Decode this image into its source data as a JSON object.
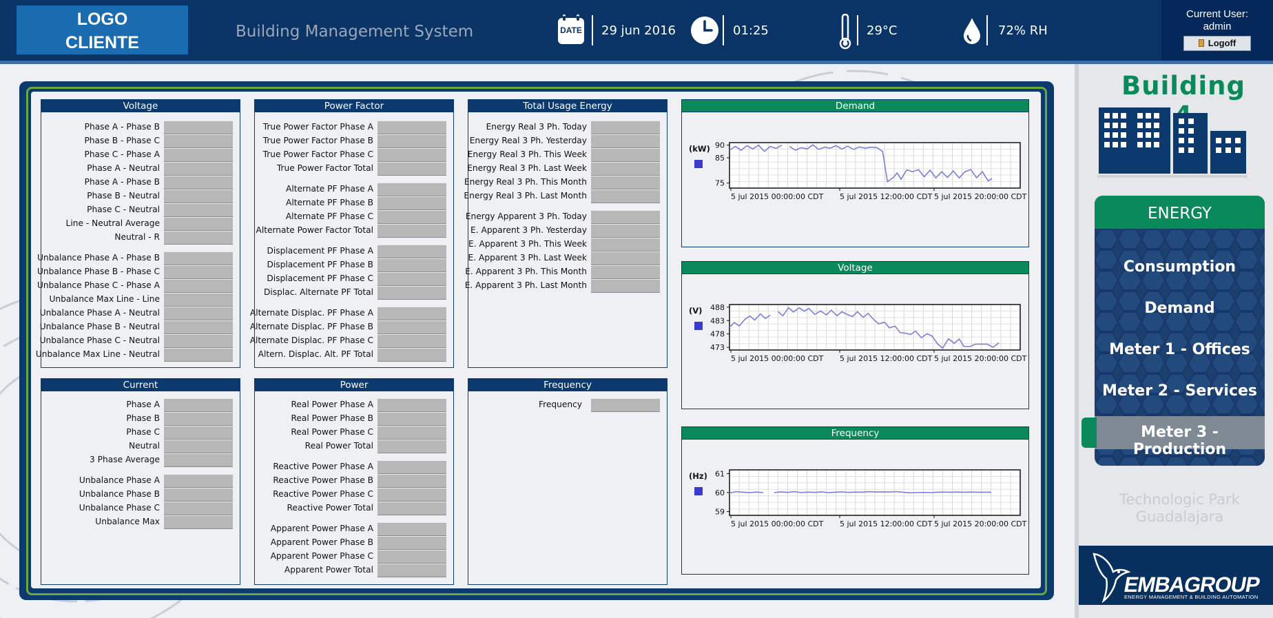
{
  "header": {
    "logo_line1": "LOGO",
    "logo_line2": "CLIENTE",
    "app_title": "Building Management System",
    "date_icon_label": "DATE",
    "date": "29 jun 2016",
    "time": "01:25",
    "temperature": "29°C",
    "humidity": "72% RH",
    "user_label": "Current User:",
    "user_name": "admin",
    "logoff_label": "Logoff"
  },
  "panels": {
    "voltage": {
      "title": "Voltage",
      "group1": [
        "Phase A - Phase B",
        "Phase B - Phase C",
        "Phase C - Phase A",
        "Phase A - Neutral",
        "Phase A - Phase B",
        "Phase B - Neutral",
        "Phase C - Neutral",
        "Line - Neutral Average",
        "Neutral - R"
      ],
      "group2": [
        "Unbalance Phase A - Phase B",
        "Unbalance Phase B - Phase C",
        "Unbalance Phase C - Phase A",
        "Unbalance Max Line - Line",
        "Unbalance Phase A - Neutral",
        "Unbalance Phase B - Neutral",
        "Unbalance Phase C - Neutral",
        "Unbalance Max Line - Neutral"
      ]
    },
    "power_factor": {
      "title": "Power Factor",
      "group1": [
        "True Power Factor Phase A",
        "True Power Factor Phase B",
        "True Power Factor Phase C",
        "True Power Factor Total"
      ],
      "group2": [
        "Alternate PF Phase A",
        "Alternate PF Phase B",
        "Alternate PF Phase C",
        "Alternate Power Factor Total"
      ],
      "group3": [
        "Displacement PF Phase A",
        "Displacement PF Phase B",
        "Displacement PF Phase C",
        "Displac. Alternate PF Total"
      ],
      "group4": [
        "Alternate Displac. PF Phase A",
        "Alternate Displac. PF Phase B",
        "Alternate Displac. PF Phase C",
        "Altern. Displac. Alt. PF Total"
      ]
    },
    "total_usage_energy": {
      "title": "Total Usage Energy",
      "group1": [
        "Energy Real 3 Ph. Today",
        "Energy Real 3 Ph. Yesterday",
        "Energy Real 3 Ph. This Week",
        "Energy Real 3 Ph. Last Week",
        "Energy Real 3 Ph. This Month",
        "Energy Real 3 Ph. Last Month"
      ],
      "group2": [
        "Energy Apparent 3 Ph. Today",
        "E. Apparent 3 Ph. Yesterday",
        "E. Apparent 3 Ph. This Week",
        "E. Apparent 3 Ph. Last Week",
        "E. Apparent 3 Ph. This Month",
        "E. Apparent 3 Ph. Last Month"
      ]
    },
    "current": {
      "title": "Current",
      "group1": [
        "Phase A",
        "Phase B",
        "Phase C",
        "Neutral",
        "3 Phase Average"
      ],
      "group2": [
        "Unbalance Phase A",
        "Unbalance Phase B",
        "Unbalance Phase C",
        "Unbalance Max"
      ]
    },
    "power": {
      "title": "Power",
      "group1": [
        "Real Power Phase A",
        "Real Power Phase B",
        "Real Power Phase C",
        "Real Power Total"
      ],
      "group2": [
        "Reactive Power Phase A",
        "Reactive Power Phase B",
        "Reactive Power Phase C",
        "Reactive Power Total"
      ],
      "group3": [
        "Apparent Power Phase A",
        "Apparent Power Phase B",
        "Apparent Power Phase C",
        "Apparent Power Total"
      ]
    },
    "frequency": {
      "title": "Frequency",
      "group1": [
        "Frequency"
      ]
    }
  },
  "chart_data": [
    {
      "type": "line",
      "title": "Demand",
      "ylabel": "(kW)",
      "ylim": [
        73,
        91
      ],
      "yticks": [
        75,
        85,
        90
      ],
      "xticks": [
        "5 jul 2015 00:00:00 CDT",
        "5 jul 2015 12:00:00 CDT",
        "5 jul 2015 20:00:00 CDT"
      ],
      "xlim": [
        0,
        30
      ],
      "grid": true,
      "series": [
        {
          "segments": [
            [
              [
                0,
                88
              ],
              [
                0.6,
                89.5
              ],
              [
                1.2,
                88
              ],
              [
                1.8,
                89.8
              ],
              [
                2.4,
                88.5
              ],
              [
                3,
                90
              ],
              [
                3.6,
                87.5
              ],
              [
                4.2,
                89.5
              ],
              [
                4.8,
                88.7
              ],
              [
                5.4,
                90
              ]
            ],
            [
              [
                6.2,
                89.5
              ],
              [
                6.8,
                88
              ],
              [
                7.4,
                89
              ],
              [
                8,
                88.5
              ],
              [
                8.6,
                90.1
              ],
              [
                9.2,
                88.3
              ],
              [
                9.8,
                89.2
              ],
              [
                10.4,
                88.8
              ],
              [
                11,
                89.8
              ],
              [
                11.6,
                88.4
              ],
              [
                12.2,
                89.6
              ],
              [
                12.8,
                88.3
              ],
              [
                13.4,
                89.3
              ],
              [
                14,
                88.8
              ],
              [
                14.6,
                89.2
              ],
              [
                15.2,
                89
              ],
              [
                15.8,
                87.5
              ],
              [
                16.3,
                75.5
              ],
              [
                16.9,
                77.2
              ],
              [
                17.3,
                79
              ],
              [
                17.7,
                76.5
              ],
              [
                18.3,
                80.2
              ],
              [
                18.9,
                79.5
              ],
              [
                19.5,
                80.3
              ],
              [
                20.1,
                77.5
              ],
              [
                20.7,
                80.1
              ],
              [
                21.3,
                77
              ],
              [
                21.9,
                79.5
              ],
              [
                22.5,
                77.2
              ],
              [
                23.1,
                79.8
              ],
              [
                23.7,
                77
              ],
              [
                24.3,
                79.5
              ],
              [
                24.9,
                80.3
              ],
              [
                25.5,
                77.1
              ],
              [
                26.1,
                79.5
              ],
              [
                26.7,
                75.8
              ],
              [
                27.1,
                76.8
              ]
            ]
          ]
        }
      ]
    },
    {
      "type": "line",
      "title": "Voltage",
      "ylabel": "(V)",
      "ylim": [
        472,
        489
      ],
      "yticks": [
        473,
        478,
        483,
        488
      ],
      "xticks": [
        "5 jul 2015 00:00:00 CDT",
        "5 jul 2015 12:00:00 CDT",
        "5 jul 2015 20:00:00 CDT"
      ],
      "xlim": [
        0,
        30
      ],
      "grid": true,
      "series": [
        {
          "segments": [
            [
              [
                0,
                480.5
              ],
              [
                0.5,
                482.3
              ],
              [
                1,
                481
              ],
              [
                1.6,
                483.5
              ],
              [
                2.1,
                484.7
              ],
              [
                2.6,
                483.2
              ],
              [
                3.2,
                485.5
              ],
              [
                3.7,
                483.8
              ],
              [
                4.2,
                485
              ]
            ],
            [
              [
                5,
                486.4
              ],
              [
                5.5,
                484.8
              ],
              [
                6.1,
                487.8
              ],
              [
                6.6,
                486.2
              ],
              [
                7.2,
                487.8
              ],
              [
                7.7,
                486.5
              ],
              [
                8.2,
                487.5
              ],
              [
                8.8,
                485.3
              ],
              [
                9.4,
                486.6
              ],
              [
                10,
                485.1
              ],
              [
                10.5,
                486.9
              ],
              [
                11.1,
                484.8
              ],
              [
                11.6,
                486.3
              ],
              [
                12.2,
                485.2
              ],
              [
                12.7,
                484.5
              ],
              [
                13.2,
                486.3
              ],
              [
                13.8,
                484.2
              ],
              [
                14.3,
                485.7
              ],
              [
                14.9,
                483.3
              ],
              [
                15.4,
                481.8
              ],
              [
                16,
                482.4
              ],
              [
                16.5,
                480.3
              ],
              [
                17.1,
                480.9
              ],
              [
                17.6,
                478.5
              ],
              [
                18.1,
                478.3
              ],
              [
                18.7,
                477.8
              ],
              [
                19.2,
                479.1
              ],
              [
                19.8,
                476.6
              ],
              [
                20.4,
                478.1
              ],
              [
                20.9,
                477.2
              ],
              [
                21.5,
                474.2
              ],
              [
                22,
                472.7
              ],
              [
                22.6,
                476.2
              ],
              [
                23.2,
                474.5
              ],
              [
                23.7,
                476.1
              ],
              [
                24.2,
                473.3
              ],
              [
                24.8,
                473.3
              ],
              [
                25.4,
                474.2
              ],
              [
                26,
                474.2
              ],
              [
                26.6,
                474.2
              ],
              [
                27.2,
                473
              ],
              [
                27.8,
                474.7
              ]
            ]
          ]
        }
      ]
    },
    {
      "type": "line",
      "title": "Frequency",
      "ylabel": "(Hz)",
      "ylim": [
        58.8,
        61.2
      ],
      "yticks": [
        59,
        60,
        61
      ],
      "xticks": [
        "5 jul 2015 00:00:00 CDT",
        "5 jul 2015 12:00:00 CDT",
        "5 jul 2015 20:00:00 CDT"
      ],
      "xlim": [
        0,
        30
      ],
      "grid": true,
      "series": [
        {
          "segments": [
            [
              [
                0,
                59.98
              ],
              [
                0.7,
                60.05
              ],
              [
                1.4,
                60.02
              ],
              [
                2.1,
                60
              ],
              [
                2.8,
                60.03
              ],
              [
                3.5,
                60
              ]
            ],
            [
              [
                4.6,
                60
              ],
              [
                5.3,
                60.04
              ],
              [
                6,
                60.01
              ],
              [
                6.7,
                60.05
              ],
              [
                7.4,
                60
              ],
              [
                8.1,
                60.03
              ],
              [
                8.8,
                60.01
              ],
              [
                9.5,
                60.04
              ],
              [
                10.2,
                60
              ],
              [
                10.9,
                60.02
              ],
              [
                11.6,
                60.04
              ],
              [
                12.3,
                60.01
              ],
              [
                13,
                60.03
              ],
              [
                13.7,
                60.02
              ],
              [
                14.4,
                60.05
              ],
              [
                15.1,
                60.03
              ],
              [
                15.8,
                60.04
              ],
              [
                16.5,
                60.03
              ],
              [
                17.2,
                60.05
              ],
              [
                17.9,
                60.02
              ],
              [
                18.6,
                59.99
              ],
              [
                19.3,
                60
              ],
              [
                20,
                60.01
              ],
              [
                20.7,
                60
              ],
              [
                21.4,
                60.02
              ],
              [
                22.1,
                60.03
              ],
              [
                22.8,
                60.02
              ],
              [
                23.5,
                60.03
              ],
              [
                24.2,
                60.02
              ],
              [
                24.9,
                60.03
              ],
              [
                25.6,
                60.02
              ],
              [
                26.3,
                60.02
              ],
              [
                27,
                60.02
              ]
            ]
          ]
        }
      ]
    }
  ],
  "sidebar": {
    "building_title": "Building 4",
    "energy_title": "ENERGY",
    "items": [
      "Consumption",
      "Demand",
      "Meter 1 - Offices",
      "Meter 2 - Services",
      "Meter 3 - Production"
    ],
    "active_index": 4,
    "location_line1": "Technologic Park",
    "location_line2": "Guadalajara",
    "brand_name": "EMBAGROUP",
    "brand_tagline": "ENERGY MANAGEMENT & BUILDING AUTOMATION"
  },
  "colors": {
    "navy": "#0c3a6e",
    "header_navy": "#0a3366",
    "accent_green": "#0a8a5a",
    "series_line": "#7a7ed8",
    "legend_swatch": "#3a3acb",
    "value_box_gray": "#b7b7b7"
  }
}
